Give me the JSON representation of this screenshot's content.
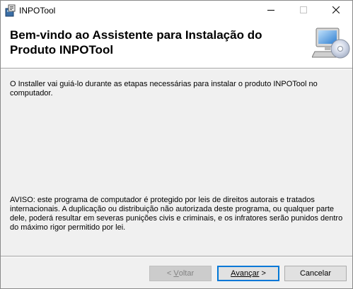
{
  "window": {
    "title": "INPOTool",
    "icon": "installer-package-icon",
    "controls": {
      "minimize": "minimize-icon",
      "maximize": "maximize-icon",
      "close": "close-icon"
    }
  },
  "banner": {
    "title_line1": "Bem-vindo ao Assistente para Instalação do",
    "title_line2": "Produto INPOTool",
    "icon": "computer-cd-icon"
  },
  "body": {
    "intro": "O Installer vai guiá-lo durante as etapas necessárias para instalar o produto INPOTool no computador.",
    "warning": "AVISO: este programa de computador é protegido por leis de direitos autorais e tratados internacionais. A duplicação ou distribuição não autorizada deste programa, ou qualquer parte dele, poderá resultar em severas punições civis e criminais, e os infratores serão punidos dentro do máximo rigor permitido por lei."
  },
  "buttons": {
    "back_prefix": "< ",
    "back_mnemonic": "V",
    "back_rest": "oltar",
    "next_mnemonic": "A",
    "next_rest": "vançar",
    "next_suffix": " >",
    "cancel": "Cancelar"
  },
  "colors": {
    "focus_border": "#0078d7",
    "dialog_background": "#f0f0f0",
    "disabled_text": "#838383"
  }
}
